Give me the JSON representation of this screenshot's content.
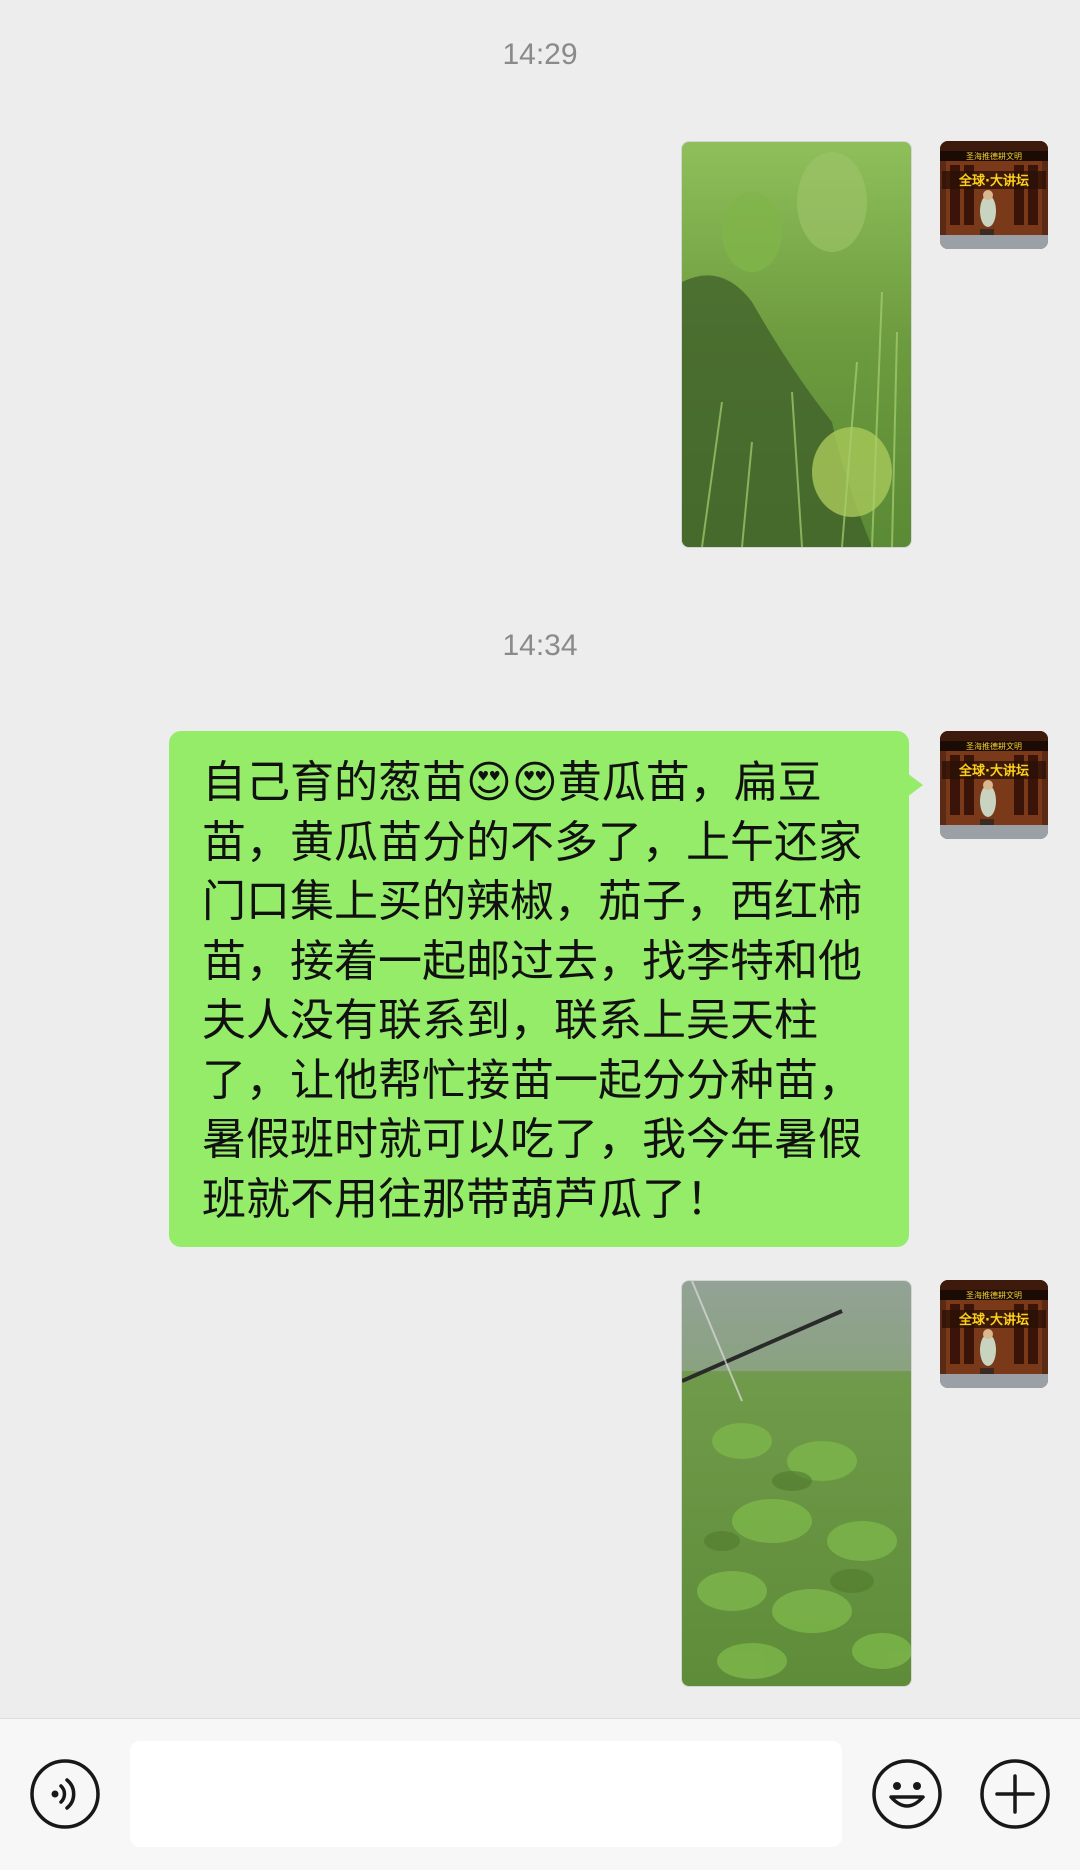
{
  "chat": {
    "timestamps": [
      "14:29",
      "14:34"
    ],
    "message_text": "自己育的葱苗😍😍黄瓜苗，扁豆苗，黄瓜苗分的不多了，上午还家门口集上买的辣椒，茄子，西红柿苗，接着一起邮过去，找李特和他夫人没有联系到，联系上吴天柱了，让他帮忙接苗一起分分种苗，暑假班时就可以吃了，我今年暑假班就不用往那带葫芦瓜了！"
  },
  "avatar": {
    "banner_top": "圣海推德耕文明",
    "banner_main": "全球·大讲坛"
  },
  "input_bar": {
    "icons": [
      "voice-icon",
      "emoji-icon",
      "plus-icon"
    ],
    "input_value": ""
  },
  "colors": {
    "background": "#ededed",
    "bubble": "#95ec69",
    "bottom_bar": "#f7f7f7"
  }
}
